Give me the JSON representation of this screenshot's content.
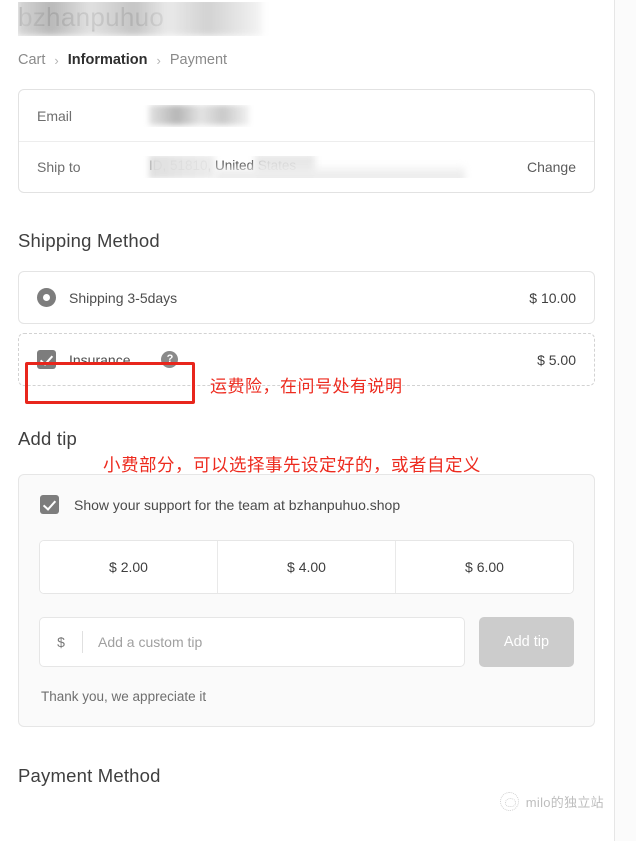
{
  "header": {
    "store_title": "bzhanpuhuo",
    "breadcrumb": [
      {
        "label": "Cart",
        "current": false
      },
      {
        "label": "Information",
        "current": true
      },
      {
        "label": "Payment",
        "current": false
      }
    ],
    "separator": "›"
  },
  "info_card": {
    "email_label": "Email",
    "email_value": "",
    "ship_label": "Ship to",
    "ship_value": "ID, 51810, United States",
    "change_label": "Change"
  },
  "shipping": {
    "heading": "Shipping Method",
    "options": [
      {
        "label": "Shipping 3-5days",
        "price": "$ 10.00",
        "control": "radio",
        "selected": true
      },
      {
        "label": "Insurance",
        "price": "$ 5.00",
        "control": "checkbox",
        "selected": true,
        "help_icon": "?"
      }
    ]
  },
  "annotations": [
    {
      "name": "insurance-note",
      "text": "运费险，在问号处有说明",
      "color": "#ed2b1f"
    },
    {
      "name": "tip-note",
      "text": "小费部分，可以选择事先设定好的，或者自定义",
      "color": "#ed2b1f"
    }
  ],
  "tip": {
    "heading": "Add tip",
    "support_label": "Show your support for the team at bzhanpuhuo.shop",
    "support_checked": true,
    "amounts": [
      "$ 2.00",
      "$ 4.00",
      "$ 6.00"
    ],
    "currency_symbol": "$",
    "custom_placeholder": "Add a custom tip",
    "custom_value": "",
    "add_button_label": "Add tip",
    "thanks_text": "Thank you, we appreciate it"
  },
  "payment": {
    "heading": "Payment Method"
  },
  "watermark": {
    "text": "milo的独立站"
  },
  "colors": {
    "accent_red": "#ed2b1f",
    "control_gray": "#7d7d7d",
    "button_gray": "#cccccc"
  }
}
